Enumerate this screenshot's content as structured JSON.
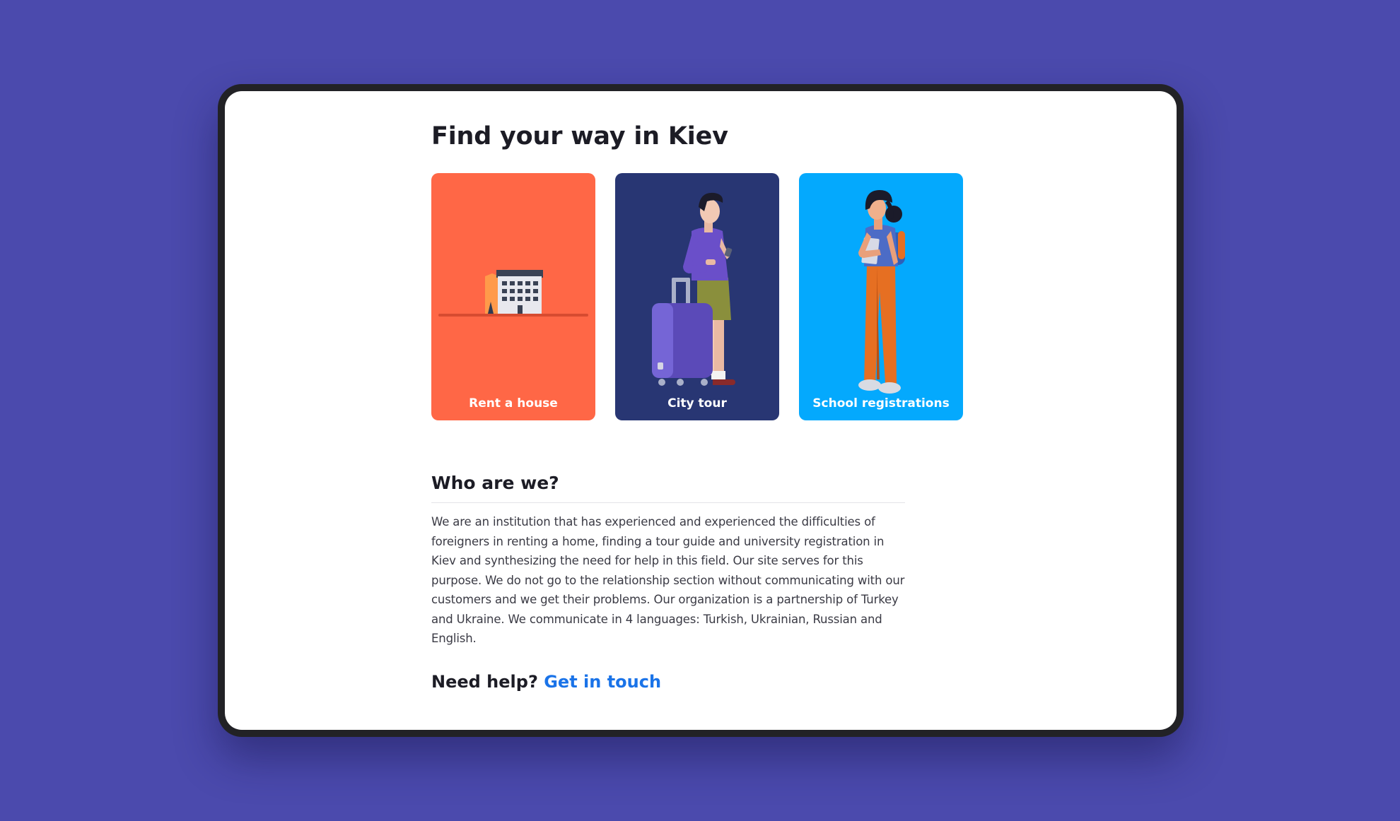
{
  "page": {
    "title": "Find your way in Kiev"
  },
  "cards": [
    {
      "label": "Rent a house",
      "color": "#ff6746",
      "icon": "house-illustration"
    },
    {
      "label": "City tour",
      "color": "#283673",
      "icon": "traveler-illustration"
    },
    {
      "label": "School registrations",
      "color": "#04a9fd",
      "icon": "student-illustration"
    }
  ],
  "about": {
    "heading": "Who are we?",
    "text": "We are an institution that has experienced and experienced the difficulties of foreigners in renting a home, finding a tour guide and university registration in Kiev and synthesizing the need for help in this field. Our site serves for this purpose. We do not go to the relationship section without communicating with our customers and we get their problems. Our organization is a partnership of Turkey and Ukraine. We communicate in 4 languages: Turkish, Ukrainian, Russian and English."
  },
  "help": {
    "prefix": "Need help?",
    "link_label": "Get in touch"
  },
  "colors": {
    "background": "#4b4aad",
    "device_frame": "#222226",
    "link": "#1a73e8"
  }
}
